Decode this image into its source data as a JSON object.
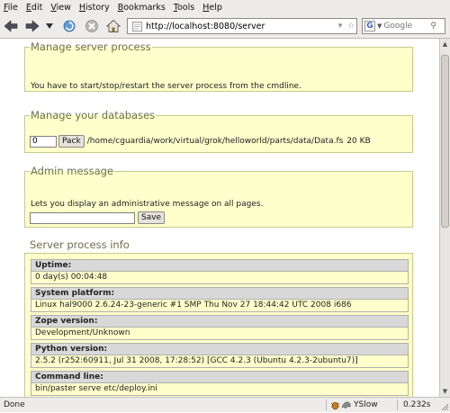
{
  "menu": [
    "File",
    "Edit",
    "View",
    "History",
    "Bookmarks",
    "Tools",
    "Help"
  ],
  "navbar": {
    "url": "http://localhost:8080/server",
    "search_placeholder": "Google",
    "search_engine_letter": "G"
  },
  "sections": {
    "manage_process": {
      "title": "Manage server process",
      "text": "You have to start/stop/restart the server process from the cmdline."
    },
    "manage_databases": {
      "title": "Manage your databases",
      "pack_days_value": "0",
      "pack_label": "Pack",
      "db_path": "/home/cguardia/work/virtual/grok/helloworld/parts/data/Data.fs",
      "db_size": "20 KB"
    },
    "admin_message": {
      "title": "Admin message",
      "text": "Lets you display an administrative message on all pages.",
      "message_value": "",
      "save_label": "Save"
    },
    "server_info": {
      "title": "Server process info",
      "items": [
        {
          "label": "Uptime:",
          "value": "0 day(s) 00:04:48"
        },
        {
          "label": "System platform:",
          "value": "Linux hal9000 2.6.24-23-generic #1 SMP Thu Nov 27 18:44:42 UTC 2008 i686"
        },
        {
          "label": "Zope version:",
          "value": "Development/Unknown"
        },
        {
          "label": "Python version:",
          "value": "2.5.2 (r252:60911, Jul 31 2008, 17:28:52) [GCC 4.2.3 (Ubuntu 4.2.3-2ubuntu7)]"
        },
        {
          "label": "Command line:",
          "value": "bin/paster serve etc/deploy.ini"
        }
      ]
    }
  },
  "status": {
    "left": "Done",
    "yslow": "YSlow",
    "time": "0.232s"
  },
  "colors": {
    "section_bg": "#ffffcc",
    "section_border": "#c9c98a",
    "section_title": "#6f6f48",
    "label_bg": "#d8d8d8",
    "chrome_bg": "#edeceb"
  }
}
